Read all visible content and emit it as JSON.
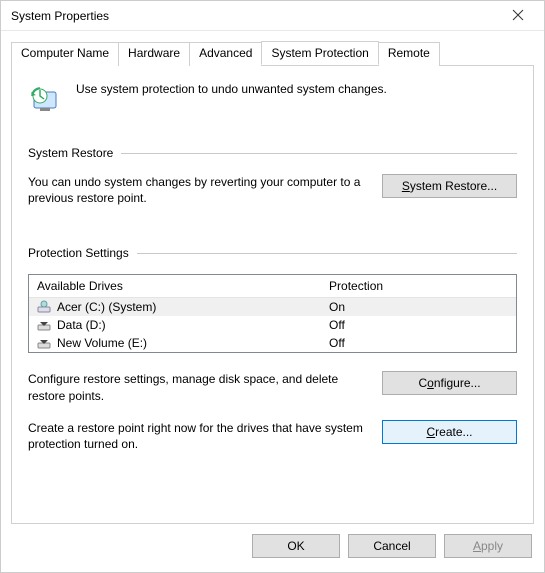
{
  "window": {
    "title": "System Properties"
  },
  "tabs": {
    "items": [
      {
        "label": "Computer Name"
      },
      {
        "label": "Hardware"
      },
      {
        "label": "Advanced"
      },
      {
        "label": "System Protection"
      },
      {
        "label": "Remote"
      }
    ],
    "active_index": 3
  },
  "intro_text": "Use system protection to undo unwanted system changes.",
  "system_restore": {
    "heading": "System Restore",
    "text": "You can undo system changes by reverting your computer to a previous restore point.",
    "button": "System Restore..."
  },
  "protection_settings": {
    "heading": "Protection Settings",
    "col_drive": "Available Drives",
    "col_protection": "Protection",
    "drives": [
      {
        "name": "Acer (C:) (System)",
        "protection": "On",
        "icon": "drive-system",
        "selected": true
      },
      {
        "name": "Data (D:)",
        "protection": "Off",
        "icon": "drive",
        "selected": false
      },
      {
        "name": "New Volume (E:)",
        "protection": "Off",
        "icon": "drive",
        "selected": false
      }
    ],
    "configure_text": "Configure restore settings, manage disk space, and delete restore points.",
    "configure_button": "Configure...",
    "create_text": "Create a restore point right now for the drives that have system protection turned on.",
    "create_button": "Create..."
  },
  "footer": {
    "ok": "OK",
    "cancel": "Cancel",
    "apply": "Apply"
  }
}
